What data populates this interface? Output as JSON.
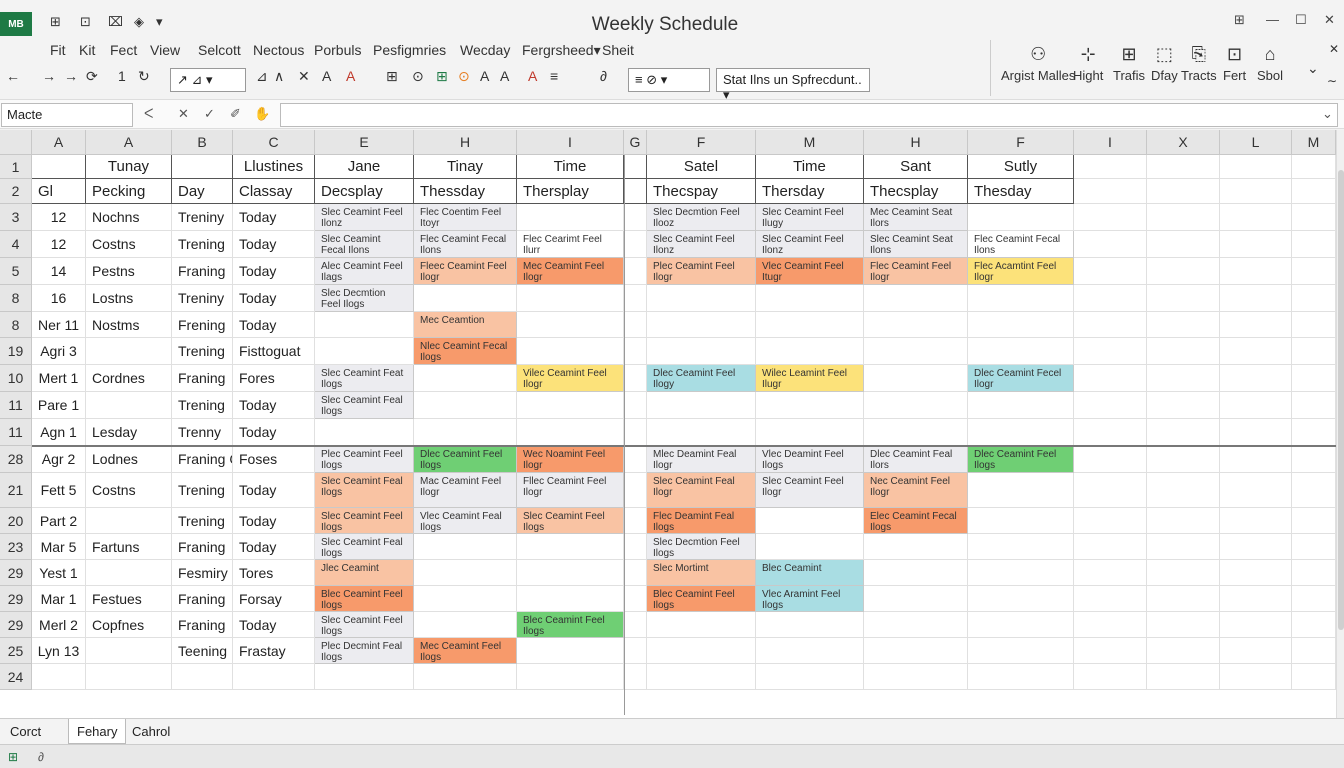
{
  "app": {
    "logo": "MB",
    "title": "Weekly Schedule"
  },
  "quick_access": [
    "⊞",
    "⊡",
    "⌧",
    "◈",
    "▾"
  ],
  "window_buttons": [
    "⊞",
    "—",
    "☐",
    "✕"
  ],
  "menus": [
    "Fit",
    "Kit",
    "Fect",
    "View",
    "Selcott",
    "Nectous",
    "Porbuls",
    "Pesfigmries",
    "Wecday",
    "Fergrsheed▾",
    "Sheit"
  ],
  "toolbar": {
    "icons": [
      "←",
      "→",
      "→",
      "⟳",
      "1",
      "↻",
      "↗",
      "⊿",
      "∧",
      "✕",
      "A",
      "⊞",
      "⊙",
      "A",
      "A",
      "A",
      "≡",
      "⊡",
      "≡",
      "∂"
    ],
    "box_icons": "↗ ⊿ ▾",
    "box_format": "≡  ⊘  ▾",
    "search_text": "Stat Ilns un Spfrecdunt.. ▾"
  },
  "ribbon_groups": [
    {
      "icon": "⚇",
      "label": "Argist Malles"
    },
    {
      "icon": "⊹",
      "label": "Hight"
    },
    {
      "icon": "⊞",
      "label": "Trafis"
    },
    {
      "icon": "⬚",
      "label": "Dfay"
    },
    {
      "icon": "⎘",
      "label": "Tracts"
    },
    {
      "icon": "⊡",
      "label": "Fert"
    },
    {
      "icon": "⌂",
      "label": "Sbol"
    }
  ],
  "ribbon_controls": [
    "⌄",
    "✕",
    "∼"
  ],
  "formula": {
    "namebox": "Macte",
    "buttons": [
      "ᐸ",
      "✕",
      "✓",
      "✐",
      "✋"
    ],
    "expand": "⌄"
  },
  "columns": [
    "A",
    "A",
    "B",
    "C",
    "E",
    "H",
    "I",
    "G",
    "F",
    "M",
    "H",
    "F",
    "I",
    "X",
    "L",
    "M"
  ],
  "rows": [
    "1",
    "2",
    "3",
    "4",
    "5",
    "8",
    "8",
    "19",
    "10",
    "11",
    "11",
    "28",
    "21",
    "20",
    "23",
    "29",
    "29",
    "29",
    "25",
    "24"
  ],
  "header_row1": [
    "",
    "Tunay",
    "",
    "Llustines",
    "Jane",
    "Tinay",
    "Time",
    "",
    "Satel",
    "Time",
    "Sant",
    "Sutly"
  ],
  "header_row2": [
    "Gl",
    "Pecking",
    "Day",
    "Classay",
    "Decsplay",
    "Thessday",
    "Thersplay",
    "",
    "Thecspay",
    "Thersday",
    "Thecsplay",
    "Thesday"
  ],
  "data_rows": [
    [
      "12",
      "Nochns",
      "Treniny",
      "Today"
    ],
    [
      "12",
      "Costns",
      "Trening",
      "Today"
    ],
    [
      "14",
      "Pestns",
      "Franing",
      "Today"
    ],
    [
      "16",
      "Lostns",
      "Treniny",
      "Today"
    ],
    [
      "Ner 11",
      "Nostms",
      "Frening",
      "Today"
    ],
    [
      "Agri 3",
      "",
      "Trening",
      "Fisttoguat"
    ],
    [
      "Mert 1",
      "Cordnes",
      "Franing",
      "Fores"
    ],
    [
      "Pare 1",
      "",
      "Trening",
      "Today"
    ],
    [
      "Agn 1",
      "Lesday",
      "Trenny",
      "Today"
    ],
    [
      "Agr 2",
      "Lodnes",
      "Franing Cled",
      "Foses"
    ],
    [
      "Fett 5",
      "Costns",
      "Trening",
      "Today"
    ],
    [
      "Part 2",
      "",
      "Trening",
      "Today"
    ],
    [
      "Mar 5",
      "Fartuns",
      "Franing",
      "Today"
    ],
    [
      "Yest 1",
      "",
      "Fesmiry",
      "Tores"
    ],
    [
      "Mar 1",
      "Festues",
      "Franing",
      "Forsay"
    ],
    [
      "Merl 2",
      "Copfnes",
      "Franing",
      "Today"
    ],
    [
      "Lyn 13",
      "",
      "Teening",
      "Frastay"
    ],
    [
      "",
      "",
      "",
      ""
    ]
  ],
  "events": [
    {
      "row": 0,
      "col": 4,
      "text": "Slec Ceamint Feel Ilonz",
      "color": "#ececf0"
    },
    {
      "row": 0,
      "col": 5,
      "text": "Flec Coentim Feel Itoyr",
      "color": "#ececf0"
    },
    {
      "row": 0,
      "col": 8,
      "text": "Slec Decmtion Feel Ilooz",
      "color": "#ececf0"
    },
    {
      "row": 0,
      "col": 9,
      "text": "Slec Ceamint Feel Ilugy",
      "color": "#ececf0"
    },
    {
      "row": 0,
      "col": 10,
      "text": "Mec Ceamint Seat Ilors",
      "color": "#ececf0"
    },
    {
      "row": 1,
      "col": 4,
      "text": "Slec Ceamint Fecal Ilons",
      "color": "#ececf0"
    },
    {
      "row": 1,
      "col": 5,
      "text": "Flec Ceamint Fecal Ilons",
      "color": "#ececf0"
    },
    {
      "row": 1,
      "col": 6,
      "text": "Flec Cearimt Feel Ilurr",
      "color": "#ffffff"
    },
    {
      "row": 1,
      "col": 8,
      "text": "Slec Ceamint Feel Ilonz",
      "color": "#ececf0"
    },
    {
      "row": 1,
      "col": 9,
      "text": "Slec Ceamint Feel Ilonz",
      "color": "#ececf0"
    },
    {
      "row": 1,
      "col": 10,
      "text": "Slec Ceamint Seat Ilons",
      "color": "#ececf0"
    },
    {
      "row": 1,
      "col": 11,
      "text": "Flec Ceamint Fecal Ilons",
      "color": "#ffffff"
    },
    {
      "row": 2,
      "col": 4,
      "text": "Alec Ceamint Feel Ilags",
      "color": "#ececf0"
    },
    {
      "row": 2,
      "col": 5,
      "text": "Fleec Ceamint Feel Ilogr",
      "color": "#f9c3a3"
    },
    {
      "row": 2,
      "col": 6,
      "text": "Mec Ceamint Feel Ilogr",
      "color": "#f79a6b"
    },
    {
      "row": 2,
      "col": 8,
      "text": "Plec Ceamint Feel Ilogr",
      "color": "#f9c3a3"
    },
    {
      "row": 2,
      "col": 9,
      "text": "Vlec Ceamint Feel Itugr",
      "color": "#f79a6b"
    },
    {
      "row": 2,
      "col": 10,
      "text": "Flec Ceamint Feel Ilogr",
      "color": "#f9c3a3"
    },
    {
      "row": 2,
      "col": 11,
      "text": "Flec Acamtint Feel Ilogr",
      "color": "#fce27a"
    },
    {
      "row": 3,
      "col": 4,
      "text": "Slec Decmtion Feel Ilogs",
      "color": "#ececf0"
    },
    {
      "row": 4,
      "col": 5,
      "text": "Mec Ceamtion",
      "color": "#f9c3a3"
    },
    {
      "row": 5,
      "col": 5,
      "text": "Nlec Ceamint Fecal Ilogs",
      "color": "#f79a6b"
    },
    {
      "row": 6,
      "col": 4,
      "text": "Slec Ceamint Feat Ilogs",
      "color": "#ececf0"
    },
    {
      "row": 6,
      "col": 6,
      "text": "Vilec Ceamint Feel Ilogr",
      "color": "#fce27a"
    },
    {
      "row": 6,
      "col": 8,
      "text": "Dlec Ceamint Feel Ilogy",
      "color": "#a9dde3"
    },
    {
      "row": 6,
      "col": 9,
      "text": "Wilec Leamint Feel Ilugr",
      "color": "#fce27a"
    },
    {
      "row": 6,
      "col": 11,
      "text": "Dlec Ceamint Fecel Ilogr",
      "color": "#a9dde3"
    },
    {
      "row": 7,
      "col": 4,
      "text": "Slec Ceamint Feal Ilogs",
      "color": "#ececf0"
    },
    {
      "row": 9,
      "col": 4,
      "text": "Plec Ceamint Feel Ilogs",
      "color": "#ececf0"
    },
    {
      "row": 9,
      "col": 5,
      "text": "Dlec Ceamint Feel Ilogs",
      "color": "#6fcf74"
    },
    {
      "row": 9,
      "col": 6,
      "text": "Wec Noamint Feel Ilogr",
      "color": "#f79a6b"
    },
    {
      "row": 9,
      "col": 8,
      "text": "Mlec Deamint Feal Ilogr",
      "color": "#ececf0"
    },
    {
      "row": 9,
      "col": 9,
      "text": "Vlec Deamint Feel Ilogs",
      "color": "#ececf0"
    },
    {
      "row": 9,
      "col": 10,
      "text": "Dlec Ceamint Feal Ilors",
      "color": "#ececf0"
    },
    {
      "row": 9,
      "col": 11,
      "text": "Dlec Ceamint Feel Ilogs",
      "color": "#6fcf74"
    },
    {
      "row": 10,
      "col": 4,
      "text": "Slec Ceamint Feal Ilogs",
      "color": "#f9c3a3"
    },
    {
      "row": 10,
      "col": 5,
      "text": "Mac Ceamint Feel Ilogr",
      "color": "#ececf0"
    },
    {
      "row": 10,
      "col": 6,
      "text": "Fllec Ceamint Feel Ilogr",
      "color": "#ececf0"
    },
    {
      "row": 10,
      "col": 8,
      "text": "Slec Ceamint Feal Ilogr",
      "color": "#f9c3a3"
    },
    {
      "row": 10,
      "col": 9,
      "text": "Slec Ceamint Feel Ilogr",
      "color": "#ececf0"
    },
    {
      "row": 10,
      "col": 10,
      "text": "Nec Ceamint Feel Ilogr",
      "color": "#f9c3a3"
    },
    {
      "row": 11,
      "col": 4,
      "text": "Slec Ceamint Feel Ilogs",
      "color": "#f9c3a3"
    },
    {
      "row": 11,
      "col": 5,
      "text": "Vlec Ceamint Feal Ilogs",
      "color": "#ececf0"
    },
    {
      "row": 11,
      "col": 6,
      "text": "Slec Ceamint Feel Ilogs",
      "color": "#f9c3a3"
    },
    {
      "row": 11,
      "col": 8,
      "text": "Flec Deamint Feal Ilogs",
      "color": "#f79a6b"
    },
    {
      "row": 11,
      "col": 10,
      "text": "Elec Ceamint Fecal Ilogs",
      "color": "#f79a6b"
    },
    {
      "row": 12,
      "col": 4,
      "text": "Slec Ceamint Feal Ilogs",
      "color": "#ececf0"
    },
    {
      "row": 12,
      "col": 8,
      "text": "Slec Decmtion Feel Ilogs",
      "color": "#ececf0"
    },
    {
      "row": 13,
      "col": 4,
      "text": "Jlec Ceamint",
      "color": "#f9c3a3"
    },
    {
      "row": 13,
      "col": 8,
      "text": "Slec Mortimt",
      "color": "#f9c3a3"
    },
    {
      "row": 13,
      "col": 9,
      "text": "Blec Ceamint",
      "color": "#a9dde3"
    },
    {
      "row": 14,
      "col": 4,
      "text": "Blec Ceamint Feel Ilogs",
      "color": "#f79a6b"
    },
    {
      "row": 14,
      "col": 8,
      "text": "Blec Ceamint Feel Ilogs",
      "color": "#f79a6b"
    },
    {
      "row": 14,
      "col": 9,
      "text": "Vlec Aramint Feel Ilogs",
      "color": "#a9dde3"
    },
    {
      "row": 15,
      "col": 4,
      "text": "Slec Ceamint Feel Ilogs",
      "color": "#ececf0"
    },
    {
      "row": 15,
      "col": 6,
      "text": "Blec Ceamint Feel Ilogs",
      "color": "#6fcf74"
    },
    {
      "row": 16,
      "col": 4,
      "text": "Plec Decmint Feal Ilogs",
      "color": "#ececf0"
    },
    {
      "row": 16,
      "col": 5,
      "text": "Mec Ceamint Feel Ilogs",
      "color": "#f79a6b"
    }
  ],
  "sheets": [
    {
      "label": "Corct",
      "active": false
    },
    {
      "label": "Fehary",
      "active": true
    },
    {
      "label": "Cahrol",
      "active": false
    }
  ],
  "status": {
    "sheet_icon": "⊞",
    "mode_icon": "∂"
  }
}
